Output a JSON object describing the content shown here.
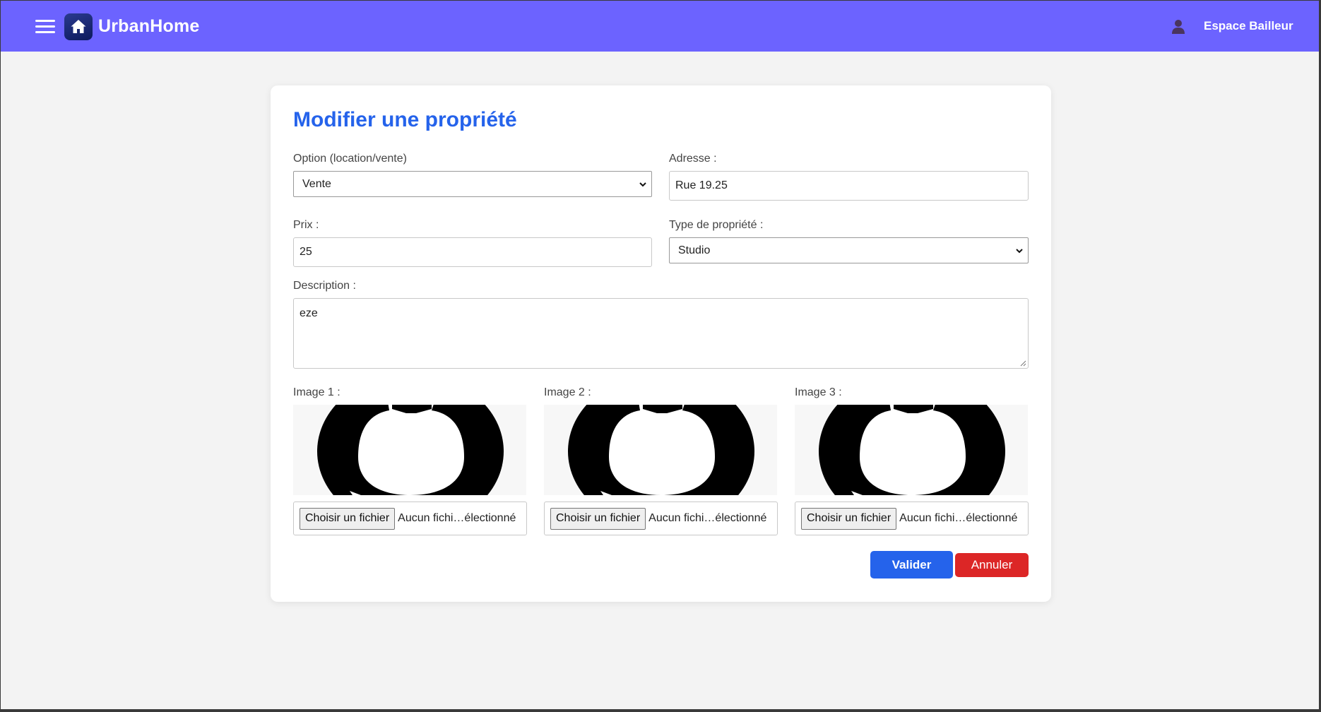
{
  "header": {
    "brand": "UrbanHome",
    "user_link": "Espace Bailleur",
    "bg_color": "#6c63ff"
  },
  "form": {
    "title": "Modifier une propriété",
    "option": {
      "label": "Option (location/vente)",
      "value": "Vente"
    },
    "adresse": {
      "label": "Adresse :",
      "value": "Rue 19.25"
    },
    "prix": {
      "label": "Prix :",
      "value": "25"
    },
    "type": {
      "label": "Type de propriété :",
      "value": "Studio"
    },
    "description": {
      "label": "Description :",
      "value": "eze"
    },
    "images": [
      {
        "label": "Image 1 :",
        "button": "Choisir un fichier",
        "status": "Aucun fichi…électionné"
      },
      {
        "label": "Image 2 :",
        "button": "Choisir un fichier",
        "status": "Aucun fichi…électionné"
      },
      {
        "label": "Image 3 :",
        "button": "Choisir un fichier",
        "status": "Aucun fichi…électionné"
      }
    ],
    "submit_label": "Valider",
    "cancel_label": "Annuler"
  },
  "colors": {
    "accent": "#2563eb",
    "danger": "#dc2626"
  }
}
